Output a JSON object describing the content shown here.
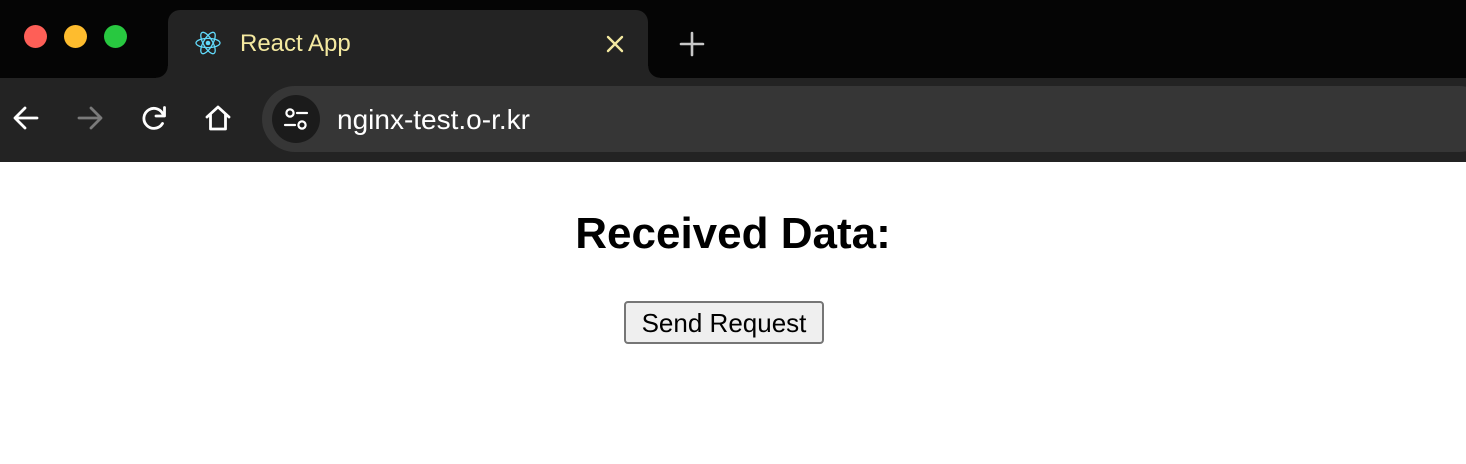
{
  "window": {
    "traffic_lights": [
      "close",
      "minimize",
      "zoom"
    ],
    "colors": {
      "close": "#fe5f57",
      "minimize": "#febc2e",
      "zoom": "#28c840"
    }
  },
  "tabs": [
    {
      "title": "React App",
      "favicon": "react-icon",
      "active": true,
      "title_color": "#f4e9a0"
    }
  ],
  "new_tab_icon": "plus-icon",
  "toolbar": {
    "buttons": [
      "back-arrow-icon",
      "forward-arrow-icon",
      "reload-icon",
      "home-icon"
    ],
    "site_info_icon": "tune-icon",
    "url": "nginx-test.o-r.kr"
  },
  "page": {
    "heading": "Received Data:",
    "button_label": "Send Request"
  }
}
